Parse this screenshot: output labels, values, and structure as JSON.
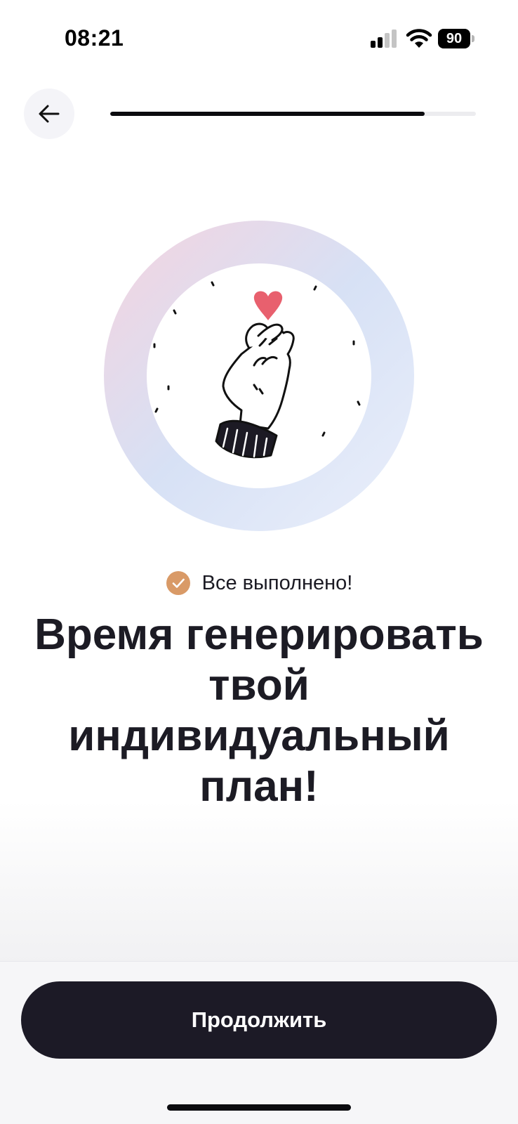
{
  "status_bar": {
    "time": "08:21",
    "battery": "90",
    "icons": [
      "signal-icon",
      "wifi-icon",
      "battery-icon"
    ]
  },
  "header": {
    "back_icon": "arrow-left-icon",
    "progress": 0.86
  },
  "illustration": {
    "icon": "finger-heart-icon",
    "ring_colors": [
      "#f2d6e2",
      "#d6e0f4",
      "#e6ecfa"
    ],
    "heart_color": "#e8606e"
  },
  "content": {
    "status_icon": "check-circle-icon",
    "status_color": "#d99a67",
    "status_text": "Все выполнено!",
    "headline": "Время генерировать твой индивидуальный план!"
  },
  "footer": {
    "continue_label": "Продолжить"
  }
}
